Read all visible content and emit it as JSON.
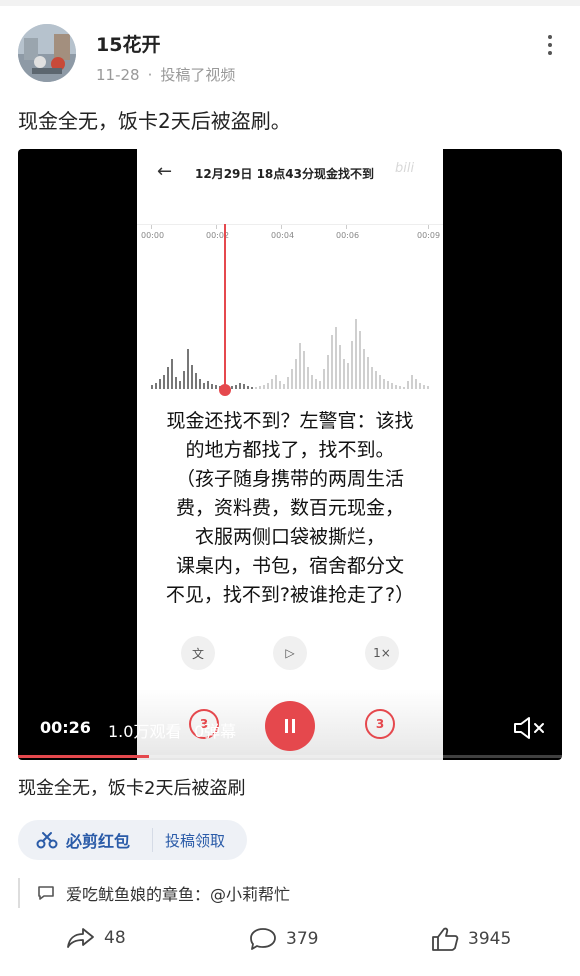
{
  "header": {
    "author": "15花开",
    "date": "11-28",
    "separator": "·",
    "action_text": "投稿了视频"
  },
  "post": {
    "text": "现金全无，饭卡2天后被盗刷。"
  },
  "video": {
    "screen": {
      "back_icon": "←",
      "title": "12月29日 18点43分现金找不到",
      "watermark": "bili",
      "timeline_labels": [
        "00:00",
        "00:02",
        "00:04",
        "00:06",
        "00:09"
      ],
      "caption": "现金还找不到？左警官：该找\n的地方都找了，找不到。\n（孩子随身携带的两周生活\n费，资料费，数百元现金，\n衣服两侧口袋被撕烂，\n课桌内，书包，宿舍都分文\n不见，找不到?被谁抢走了?）",
      "controls": {
        "text_btn": "文",
        "play_btn": "▷",
        "speed_btn": "1×",
        "skip_back": "3",
        "skip_forward": "3"
      }
    },
    "overlay": {
      "time": "00:26",
      "views": "1.0万观看",
      "danmaku": "0弹幕"
    },
    "progress": 0.24,
    "accent_color": "#e5484d"
  },
  "video_title": "现金全无，饭卡2天后被盗刷",
  "promo": {
    "label": "必剪红包",
    "action": "投稿领取"
  },
  "comment": {
    "text": "爱吃鱿鱼娘的章鱼：@小莉帮忙"
  },
  "actions": {
    "share_count": "48",
    "comment_count": "379",
    "like_count": "3945"
  }
}
